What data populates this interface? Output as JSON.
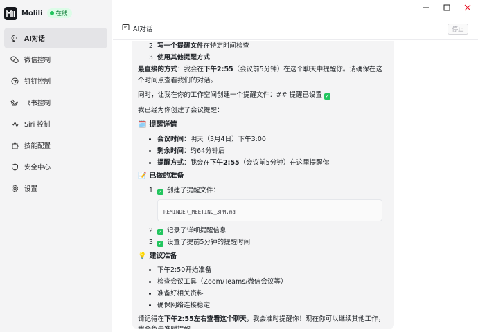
{
  "app": {
    "name": "Molili",
    "status": "在线"
  },
  "sidebar": {
    "items": [
      {
        "label": "AI对话",
        "icon": "chat-bubble-icon",
        "active": true
      },
      {
        "label": "微信控制",
        "icon": "wechat-icon",
        "active": false
      },
      {
        "label": "钉钉控制",
        "icon": "dingtalk-icon",
        "active": false
      },
      {
        "label": "飞书控制",
        "icon": "feishu-icon",
        "active": false
      },
      {
        "label": "Siri 控制",
        "icon": "siri-icon",
        "active": false
      },
      {
        "label": "技能配置",
        "icon": "puzzle-icon",
        "active": false
      },
      {
        "label": "安全中心",
        "icon": "shield-icon",
        "active": false
      },
      {
        "label": "设置",
        "icon": "gear-icon",
        "active": false
      }
    ]
  },
  "header": {
    "title": "AI对话",
    "stop_label": "停止"
  },
  "message": {
    "top_list": {
      "item2_bold": "写一个提醒文件",
      "item2_rest": "在特定时间检查",
      "item3_bold": "使用其他提醒方式"
    },
    "direct": {
      "bold1": "最直接的方式",
      "text1": "：我会在",
      "bold2": "下午2:55",
      "text2": "（会议前5分钟）在这个聊天中提醒你。请确保在这个时间点查看我们的对话。"
    },
    "workspace_line": "同时，让我在你的工作空间创建一个提醒文件：## 提醒已设置",
    "created_line": "我已经为你创建了会议提醒：",
    "details": {
      "emoji": "🗓️",
      "heading": "提醒详情",
      "time_label": "会议时间",
      "time_value": "：明天（3月4日）下午3:00",
      "remaining_label": "剩余时间",
      "remaining_value": "：约64分钟后",
      "method_label": "提醒方式",
      "method_pre": "：我会在",
      "method_bold": "下午2:55",
      "method_post": "（会议前5分钟）在这里提醒你"
    },
    "prep": {
      "emoji": "📝",
      "heading": "已做的准备",
      "step1": "创建了提醒文件：",
      "code": "REMINDER_MEETING_3PM.md",
      "step2": "记录了详细提醒信息",
      "step3": "设置了提前5分钟的提醒时间"
    },
    "suggest": {
      "emoji": "💡",
      "heading": "建议准备",
      "items": [
        "下午2:50开始准备",
        "检查会议工具（Zoom/Teams/微信会议等）",
        "准备好相关资料",
        "确保网络连接稳定"
      ]
    },
    "closing": {
      "pre": "请记得在",
      "bold": "下午2:55左右查看这个聊天",
      "post": "，我会准时提醒你！现在你可以继续其他工作，我会负责准时提醒。"
    }
  },
  "colors": {
    "accent_green": "#22c55e",
    "badge_bg": "#dcfce7",
    "close_red": "#e81123"
  }
}
